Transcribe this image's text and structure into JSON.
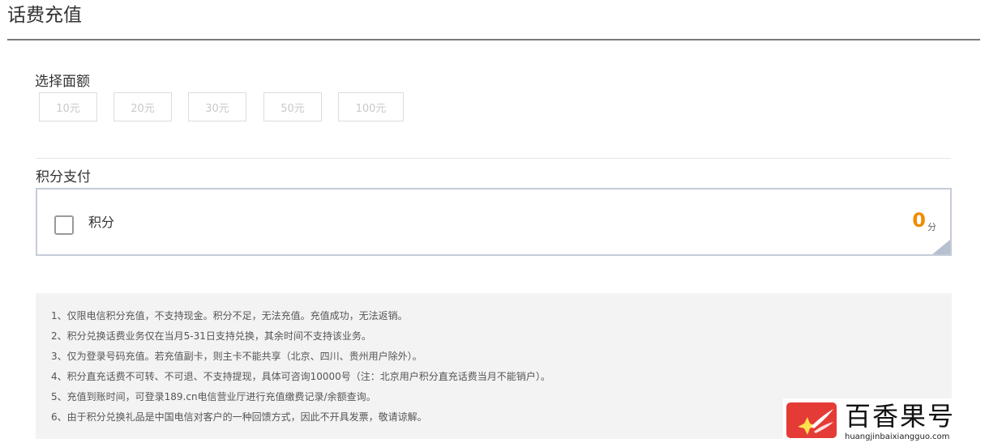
{
  "header": {
    "title": "话费充值"
  },
  "amount_section": {
    "label": "选择面额",
    "options": [
      "10元",
      "20元",
      "30元",
      "50元",
      "100元"
    ]
  },
  "points_section": {
    "label": "积分支付",
    "item_label": "积分",
    "value": "0",
    "unit": "分",
    "checked": false
  },
  "notices": [
    "1、仅限电信积分充值，不支持现金。积分不足，无法充值。充值成功，无法返销。",
    "2、积分兑换话费业务仅在当月5-31日支持兑换，其余时间不支持该业务。",
    "3、仅为登录号码充值。若充值副卡，则主卡不能共享（北京、四川、贵州用户除外）。",
    "4、积分直充话费不可转、不可退、不支持提现，具体可咨询10000号（注：北京用户积分直充话费当月不能销户）。",
    "5、充值到账时间，可登录189.cn电信营业厅进行充值缴费记录/余额查询。",
    "6、由于积分兑换礼品是中国电信对客户的一种回馈方式，因此不开具发票，敬请谅解。"
  ],
  "watermark": {
    "text": "百香果号",
    "url": "huangjinbaixiangguo.com"
  },
  "colors": {
    "points_value": "#f08c00",
    "box_border": "#c5ccd8",
    "notice_bg": "#f3f3f3",
    "logo_red": "#e53b36"
  }
}
